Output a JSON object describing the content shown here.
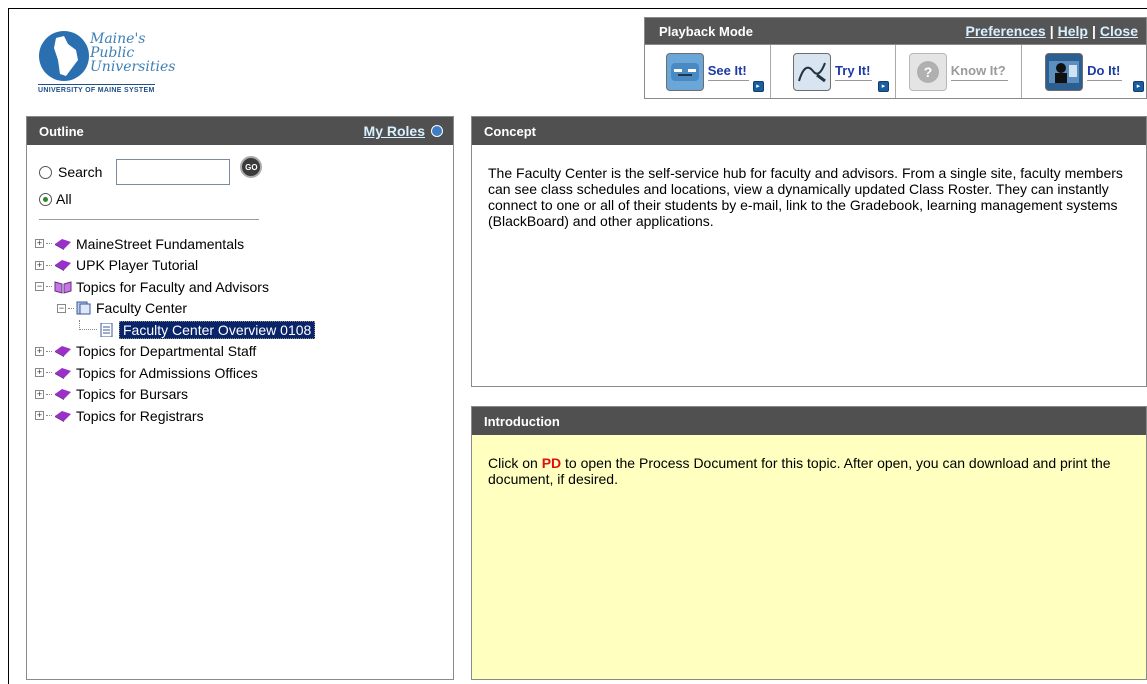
{
  "logo": {
    "line1": "Maine's",
    "line2": "Public",
    "line3": "Universities",
    "subtitle": "UNIVERSITY OF MAINE SYSTEM"
  },
  "playback": {
    "title": "Playback Mode",
    "links": [
      "Preferences",
      "Help",
      "Close"
    ],
    "buttons": [
      {
        "label": "See It!",
        "icon": "see-it-icon",
        "enabled": true
      },
      {
        "label": "Try It!",
        "icon": "try-it-icon",
        "enabled": true
      },
      {
        "label": "Know It?",
        "icon": "know-it-icon",
        "enabled": false
      },
      {
        "label": "Do It!",
        "icon": "do-it-icon",
        "enabled": true
      }
    ]
  },
  "outline": {
    "title": "Outline",
    "my_roles": "My Roles",
    "search_label": "Search",
    "search_value": "",
    "go_label": "GO",
    "all_label": "All",
    "tree": [
      {
        "label": "MaineStreet Fundamentals"
      },
      {
        "label": "UPK Player Tutorial"
      },
      {
        "label": "Topics for Faculty and Advisors"
      },
      {
        "label": "Faculty Center"
      },
      {
        "label": "Faculty Center Overview 0108"
      },
      {
        "label": "Topics for Departmental Staff"
      },
      {
        "label": "Topics for Admissions Offices"
      },
      {
        "label": "Topics for Bursars"
      },
      {
        "label": "Topics for Registrars"
      }
    ]
  },
  "concept": {
    "title": "Concept",
    "text": "The Faculty Center is the self-service hub for faculty and advisors. From a single site, faculty members can see class schedules and locations, view a dynamically updated Class Roster. They can instantly connect to one or all of their students by e-mail, link to the Gradebook, learning management systems (BlackBoard) and other applications."
  },
  "introduction": {
    "title": "Introduction",
    "text_before": "Click on",
    "pd": "PD",
    "text_after": "to open the Process Document for this topic. After open, you can download and print the document, if desired."
  },
  "colors": {
    "header_bar": "#505050",
    "link": "#d8f0ff",
    "intro_bg": "#ffffc0",
    "selected_bg": "#0a246a",
    "book_icon": "#9b30c8"
  }
}
